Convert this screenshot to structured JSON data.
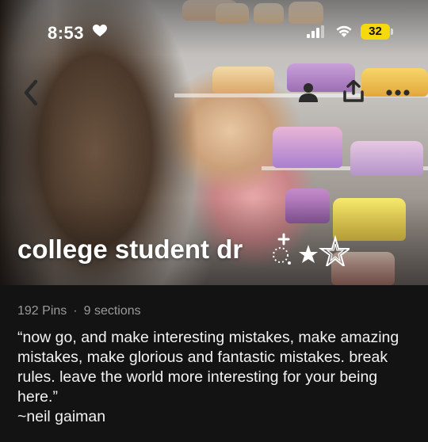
{
  "status_bar": {
    "time": "8:53",
    "battery": "32",
    "icons": [
      "heart-icon",
      "signal-icon",
      "wifi-icon",
      "battery-icon"
    ],
    "battery_color": "#f5d90a"
  },
  "nav": {
    "icons": [
      "back-icon",
      "profile-icon",
      "share-icon",
      "more-icon"
    ]
  },
  "board": {
    "title": "college student dr",
    "title_decoration": "sparkle-star-icons",
    "pins": "192 Pins",
    "separator": "·",
    "sections": "9 sections",
    "description": "“now go, and make interesting mistakes, make amazing mistakes, make glorious and fantastic mistakes. break rules. leave the world more interesting for your being here.”\n~neil gaiman"
  },
  "colors": {
    "background": "#131313",
    "meta_text": "#9a9a9a",
    "body_text": "#f2f2f2"
  }
}
